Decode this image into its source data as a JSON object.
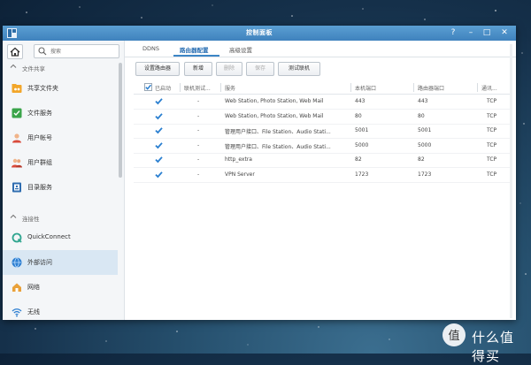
{
  "window": {
    "title": "控制面板",
    "controls": {
      "help": "?",
      "minimize": "–",
      "maximize": "□",
      "close": "✕"
    }
  },
  "sidebar": {
    "search_placeholder": "搜索",
    "sections": [
      {
        "label": "文件共享",
        "items": [
          {
            "label": "共享文件夹",
            "icon": "shared-folder-icon"
          },
          {
            "label": "文件服务",
            "icon": "file-services-icon"
          },
          {
            "label": "用户帐号",
            "icon": "user-icon"
          },
          {
            "label": "用户群组",
            "icon": "group-icon"
          },
          {
            "label": "目录服务",
            "icon": "directory-icon"
          }
        ]
      },
      {
        "label": "连接性",
        "items": [
          {
            "label": "QuickConnect",
            "icon": "quickconnect-icon"
          },
          {
            "label": "外部访问",
            "icon": "external-access-icon",
            "active": true
          },
          {
            "label": "网络",
            "icon": "network-icon"
          },
          {
            "label": "无线",
            "icon": "wireless-icon"
          }
        ]
      }
    ]
  },
  "tabs": [
    {
      "label": "DDNS"
    },
    {
      "label": "路由器配置",
      "active": true
    },
    {
      "label": "高级设置"
    }
  ],
  "toolbar": {
    "setup_router": "设置路由器",
    "create": "新增",
    "delete": "删除",
    "save": "保存",
    "test_connection": "测试联机"
  },
  "table": {
    "columns": [
      "已启动",
      "联机测试...",
      "服务",
      "本机端口",
      "路由器端口",
      "通讯..."
    ],
    "rows": [
      {
        "enabled": true,
        "test": "-",
        "service": "Web Station, Photo Station, Web Mail",
        "local_port": "443",
        "router_port": "443",
        "protocol": "TCP"
      },
      {
        "enabled": true,
        "test": "-",
        "service": "Web Station, Photo Station, Web Mail",
        "local_port": "80",
        "router_port": "80",
        "protocol": "TCP"
      },
      {
        "enabled": true,
        "test": "-",
        "service": "管理用户接口、File Station、Audio Stati...",
        "local_port": "5001",
        "router_port": "5001",
        "protocol": "TCP"
      },
      {
        "enabled": true,
        "test": "-",
        "service": "管理用户接口、File Station、Audio Stati...",
        "local_port": "5000",
        "router_port": "5000",
        "protocol": "TCP"
      },
      {
        "enabled": true,
        "test": "-",
        "service": "http_extra",
        "local_port": "82",
        "router_port": "82",
        "protocol": "TCP"
      },
      {
        "enabled": true,
        "test": "-",
        "service": "VPN Server",
        "local_port": "1723",
        "router_port": "1723",
        "protocol": "TCP"
      }
    ]
  },
  "watermark": {
    "text": "什么值得买",
    "logo_glyph": "值"
  },
  "colors": {
    "accent": "#3c86c6",
    "titlebar": "#4a8fc8",
    "check": "#2a7fd0",
    "active_nav": "#d9e7f3"
  }
}
